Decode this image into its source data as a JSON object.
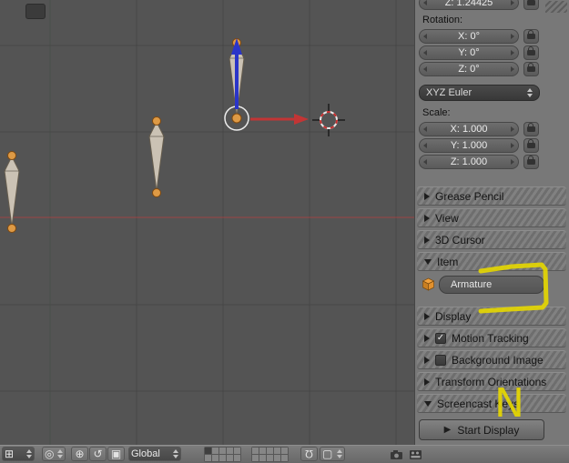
{
  "viewport": {
    "background": "#545454",
    "grid_color": "#474747",
    "x_axis_color": "#9c4343",
    "bone_count": 3,
    "bone_fill": "#cbc2b4",
    "joint_color": "#de9a45"
  },
  "icons": {
    "editor_type": "⊞",
    "pivot": "◎",
    "manip_translate": "⊕",
    "manip_rotate": "↺",
    "manip_scale": "▣",
    "magnet": "Ω",
    "snap_element": "▢",
    "play": "▶",
    "check": "✓"
  },
  "side_panel": {
    "transform": {
      "z_location": "Z: 1.24425",
      "rotation_label": "Rotation:",
      "rotation_x": "X: 0°",
      "rotation_y": "Y: 0°",
      "rotation_z": "Z: 0°",
      "rotation_mode": "XYZ Euler",
      "scale_label": "Scale:",
      "scale_x": "X: 1.000",
      "scale_y": "Y: 1.000",
      "scale_z": "Z: 1.000"
    },
    "sections": {
      "grease_pencil": "Grease Pencil",
      "view": "View",
      "cursor_3d": "3D Cursor",
      "item": "Item",
      "display": "Display",
      "motion_tracking": "Motion Tracking",
      "background_image": "Background Image",
      "transform_orientations": "Transform Orientations",
      "screencast_keys": "Screencast Keys"
    },
    "item_panel": {
      "name_value": "Armature"
    },
    "screencast": {
      "start_button": "Start Display"
    }
  },
  "toolbar": {
    "orientation": "Global"
  },
  "annotations": {
    "letter": "N",
    "color": "#e6d700"
  }
}
